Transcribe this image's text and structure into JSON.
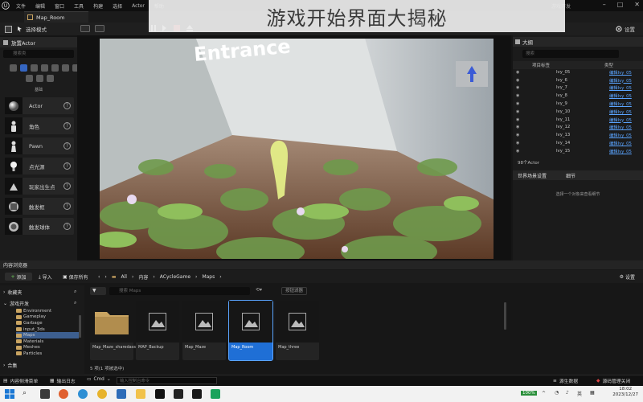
{
  "window": {
    "level_tab": "Map_Room",
    "menu": [
      "文件",
      "编辑",
      "窗口",
      "工具",
      "构建",
      "选择",
      "Actor",
      "帮助"
    ],
    "project_name": "游戏开发"
  },
  "banner": {
    "text": "游戏开始界面大揭秘"
  },
  "toolbar": {
    "mode_label": "选择模式",
    "settings_label": "设置"
  },
  "place_actors": {
    "title": "放置Actor",
    "search_placeholder": "搜索类",
    "category_label": "基础",
    "items": [
      {
        "label": "Actor",
        "icon": "sphere-icon"
      },
      {
        "label": "角色",
        "icon": "character-icon"
      },
      {
        "label": "Pawn",
        "icon": "pawn-icon"
      },
      {
        "label": "点光源",
        "icon": "point-light-icon"
      },
      {
        "label": "玩家出生点",
        "icon": "player-start-icon"
      },
      {
        "label": "触发框",
        "icon": "trigger-box-icon"
      },
      {
        "label": "触发球体",
        "icon": "trigger-sphere-icon"
      }
    ]
  },
  "viewport": {
    "scene_text": "Entrance"
  },
  "outliner": {
    "title": "大纲",
    "search_placeholder": "搜索",
    "col_label": "项目标签",
    "col_type": "类型",
    "rows": [
      {
        "name": "Ivy_05",
        "type": "编辑Ivy_05"
      },
      {
        "name": "Ivy_6",
        "type": "编辑Ivy_05"
      },
      {
        "name": "Ivy_7",
        "type": "编辑Ivy_05"
      },
      {
        "name": "Ivy_8",
        "type": "编辑Ivy_05"
      },
      {
        "name": "Ivy_9",
        "type": "编辑Ivy_05"
      },
      {
        "name": "Ivy_10",
        "type": "编辑Ivy_05"
      },
      {
        "name": "Ivy_11",
        "type": "编辑Ivy_05"
      },
      {
        "name": "Ivy_12",
        "type": "编辑Ivy_05"
      },
      {
        "name": "Ivy_13",
        "type": "编辑Ivy_05"
      },
      {
        "name": "Ivy_14",
        "type": "编辑Ivy_05"
      },
      {
        "name": "Ivy_15",
        "type": "编辑Ivy_05"
      }
    ],
    "count": "98个Actor"
  },
  "details": {
    "tab_world": "世界场景设置",
    "tab_details": "细节",
    "empty_text": "选择一个对象来查看细节"
  },
  "content_browser": {
    "title": "内容浏览器",
    "add_label": "添加",
    "import_label": "导入",
    "save_all_label": "保存所有",
    "breadcrumb": [
      "All",
      "内容",
      "ACycleGame",
      "Maps"
    ],
    "settings_label": "设置",
    "search_placeholder": "搜索 Maps",
    "filter_label": "按钮滤器",
    "favorites_label": "收藏夹",
    "project_label": "游戏开发",
    "folders": [
      "Environment",
      "Gameplay",
      "Garbage",
      "input_3ds",
      "Maps",
      "Materials",
      "Meshes",
      "Particles"
    ],
    "selected_folder": "Maps",
    "collections_label": "合集",
    "assets": [
      {
        "name": "Map_Maze_sharedassets",
        "kind": "folder"
      },
      {
        "name": "MAP_Backup",
        "kind": "map"
      },
      {
        "name": "Map_Maze",
        "kind": "map"
      },
      {
        "name": "Map_Room",
        "kind": "map"
      },
      {
        "name": "Map_three",
        "kind": "map"
      }
    ],
    "selected_asset": "Map_Room",
    "status": "5 项(1 项被选中)"
  },
  "statusbar": {
    "content_drawer": "内容侧滑菜单",
    "output_log": "输出日志",
    "cmd": "Cmd",
    "cmd_placeholder": "输入控制台命令",
    "source_data": "源生数据",
    "source_control": "源码管理关闭"
  },
  "taskbar": {
    "battery": "100%",
    "ime": "英",
    "time": "18:02",
    "date": "2023/12/27"
  }
}
